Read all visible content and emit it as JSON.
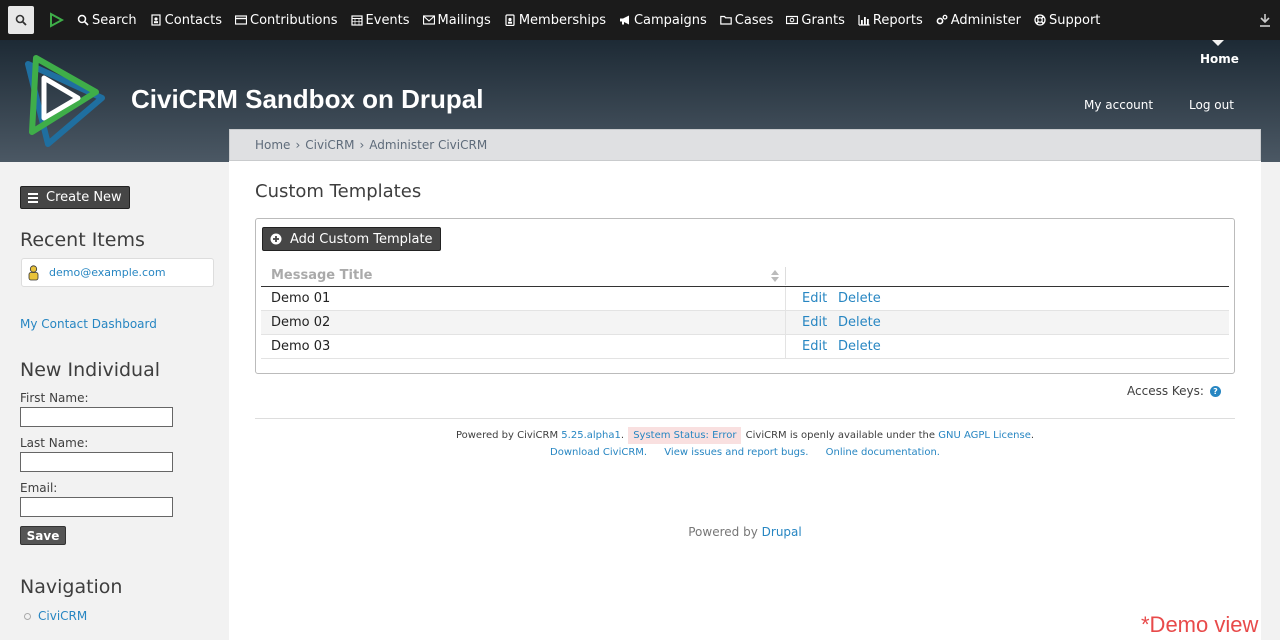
{
  "menu": {
    "items": [
      {
        "label": "Search",
        "icon": "search-icon"
      },
      {
        "label": "Contacts",
        "icon": "contacts-icon"
      },
      {
        "label": "Contributions",
        "icon": "credit-card-icon"
      },
      {
        "label": "Events",
        "icon": "calendar-icon"
      },
      {
        "label": "Mailings",
        "icon": "envelope-icon"
      },
      {
        "label": "Memberships",
        "icon": "id-badge-icon"
      },
      {
        "label": "Campaigns",
        "icon": "bullhorn-icon"
      },
      {
        "label": "Cases",
        "icon": "folder-icon"
      },
      {
        "label": "Grants",
        "icon": "money-icon"
      },
      {
        "label": "Reports",
        "icon": "bar-chart-icon"
      },
      {
        "label": "Administer",
        "icon": "cogs-icon"
      },
      {
        "label": "Support",
        "icon": "life-ring-icon"
      }
    ]
  },
  "header": {
    "site_name": "CiviCRM Sandbox on Drupal",
    "home_tab": "Home",
    "my_account": "My account",
    "logout": "Log out"
  },
  "breadcrumb": {
    "items": [
      "Home",
      "CiviCRM",
      "Administer CiviCRM"
    ],
    "separator": "›"
  },
  "sidebar": {
    "create_new": "Create New",
    "recent_heading": "Recent Items",
    "recent_item": "demo@example.com",
    "dashboard_link": "My Contact Dashboard",
    "new_individual_heading": "New Individual",
    "first_name_label": "First Name:",
    "last_name_label": "Last Name:",
    "email_label": "Email:",
    "first_name_value": "",
    "last_name_value": "",
    "email_value": "",
    "save_label": "Save",
    "navigation_heading": "Navigation",
    "nav_items": [
      "CiviCRM"
    ]
  },
  "main": {
    "page_title": "Custom Templates",
    "add_button": "Add Custom Template",
    "column_header": "Message Title",
    "rows": [
      {
        "title": "Demo 01",
        "edit": "Edit",
        "delete": "Delete"
      },
      {
        "title": "Demo 02",
        "edit": "Edit",
        "delete": "Delete"
      },
      {
        "title": "Demo 03",
        "edit": "Edit",
        "delete": "Delete"
      }
    ],
    "access_keys": "Access Keys:",
    "help_icon_glyph": "?"
  },
  "footer": {
    "powered_by": "Powered by CiviCRM",
    "version": "5.25.alpha1",
    "dot": ".",
    "system_status": "System Status: Error",
    "available_text": "CiviCRM is openly available under the",
    "license": "GNU AGPL License",
    "download": "Download CiviCRM.",
    "issues": "View issues and report bugs.",
    "docs": "Online documentation.",
    "powered_by_prefix": "Powered by",
    "drupal": "Drupal"
  },
  "overlay": {
    "demo_view": "*Demo view"
  },
  "colors": {
    "link": "#2786c2",
    "topbar": "#1b1b1b",
    "button": "#464646",
    "demo_red": "#e84a4a"
  }
}
